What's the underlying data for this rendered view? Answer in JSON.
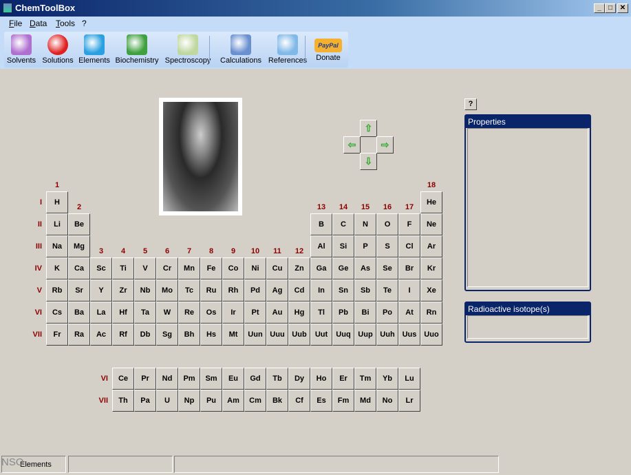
{
  "window": {
    "title": "ChemToolBox",
    "minimize": "_",
    "maximize": "□",
    "close": "✕"
  },
  "menu": [
    "File",
    "Data",
    "Tools",
    "?"
  ],
  "toolbar": [
    {
      "label": "Solvents",
      "icon": "beaker-icon",
      "color": "#b070d0"
    },
    {
      "label": "Solutions",
      "icon": "molecule-icon",
      "color": "#e02020"
    },
    {
      "label": "Elements",
      "icon": "cubes-icon",
      "color": "#2aa0e0"
    },
    {
      "label": "Biochemistry",
      "icon": "protein-icon",
      "color": "#40a040"
    },
    {
      "label": "Spectroscopy",
      "icon": "spectrum-icon",
      "color": "#c0d8a0"
    },
    {
      "label": "Calculations",
      "icon": "calculator-icon",
      "color": "#6a90d0"
    },
    {
      "label": "References",
      "icon": "book-icon",
      "color": "#80b8e8"
    },
    {
      "label": "Donate",
      "icon": "paypal-icon",
      "color": "#f0a020"
    }
  ],
  "paypal_text": "PayPal",
  "groups": [
    "1",
    "2",
    "3",
    "4",
    "5",
    "6",
    "7",
    "8",
    "9",
    "10",
    "11",
    "12",
    "13",
    "14",
    "15",
    "16",
    "17",
    "18"
  ],
  "periods": [
    "I",
    "II",
    "III",
    "IV",
    "V",
    "VI",
    "VII"
  ],
  "elements": [
    [
      "H",
      1,
      1
    ],
    [
      "He",
      18,
      1
    ],
    [
      "Li",
      1,
      2
    ],
    [
      "Be",
      2,
      2
    ],
    [
      "B",
      13,
      2
    ],
    [
      "C",
      14,
      2
    ],
    [
      "N",
      15,
      2
    ],
    [
      "O",
      16,
      2
    ],
    [
      "F",
      17,
      2
    ],
    [
      "Ne",
      18,
      2
    ],
    [
      "Na",
      1,
      3
    ],
    [
      "Mg",
      2,
      3
    ],
    [
      "Al",
      13,
      3
    ],
    [
      "Si",
      14,
      3
    ],
    [
      "P",
      15,
      3
    ],
    [
      "S",
      16,
      3
    ],
    [
      "Cl",
      17,
      3
    ],
    [
      "Ar",
      18,
      3
    ],
    [
      "K",
      1,
      4
    ],
    [
      "Ca",
      2,
      4
    ],
    [
      "Sc",
      3,
      4
    ],
    [
      "Ti",
      4,
      4
    ],
    [
      "V",
      5,
      4
    ],
    [
      "Cr",
      6,
      4
    ],
    [
      "Mn",
      7,
      4
    ],
    [
      "Fe",
      8,
      4
    ],
    [
      "Co",
      9,
      4
    ],
    [
      "Ni",
      10,
      4
    ],
    [
      "Cu",
      11,
      4
    ],
    [
      "Zn",
      12,
      4
    ],
    [
      "Ga",
      13,
      4
    ],
    [
      "Ge",
      14,
      4
    ],
    [
      "As",
      15,
      4
    ],
    [
      "Se",
      16,
      4
    ],
    [
      "Br",
      17,
      4
    ],
    [
      "Kr",
      18,
      4
    ],
    [
      "Rb",
      1,
      5
    ],
    [
      "Sr",
      2,
      5
    ],
    [
      "Y",
      3,
      5
    ],
    [
      "Zr",
      4,
      5
    ],
    [
      "Nb",
      5,
      5
    ],
    [
      "Mo",
      6,
      5
    ],
    [
      "Tc",
      7,
      5
    ],
    [
      "Ru",
      8,
      5
    ],
    [
      "Rh",
      9,
      5
    ],
    [
      "Pd",
      10,
      5
    ],
    [
      "Ag",
      11,
      5
    ],
    [
      "Cd",
      12,
      5
    ],
    [
      "In",
      13,
      5
    ],
    [
      "Sn",
      14,
      5
    ],
    [
      "Sb",
      15,
      5
    ],
    [
      "Te",
      16,
      5
    ],
    [
      "I",
      17,
      5
    ],
    [
      "Xe",
      18,
      5
    ],
    [
      "Cs",
      1,
      6
    ],
    [
      "Ba",
      2,
      6
    ],
    [
      "La",
      3,
      6
    ],
    [
      "Hf",
      4,
      6
    ],
    [
      "Ta",
      5,
      6
    ],
    [
      "W",
      6,
      6
    ],
    [
      "Re",
      7,
      6
    ],
    [
      "Os",
      8,
      6
    ],
    [
      "Ir",
      9,
      6
    ],
    [
      "Pt",
      10,
      6
    ],
    [
      "Au",
      11,
      6
    ],
    [
      "Hg",
      12,
      6
    ],
    [
      "Tl",
      13,
      6
    ],
    [
      "Pb",
      14,
      6
    ],
    [
      "Bi",
      15,
      6
    ],
    [
      "Po",
      16,
      6
    ],
    [
      "At",
      17,
      6
    ],
    [
      "Rn",
      18,
      6
    ],
    [
      "Fr",
      1,
      7
    ],
    [
      "Ra",
      2,
      7
    ],
    [
      "Ac",
      3,
      7
    ],
    [
      "Rf",
      4,
      7
    ],
    [
      "Db",
      5,
      7
    ],
    [
      "Sg",
      6,
      7
    ],
    [
      "Bh",
      7,
      7
    ],
    [
      "Hs",
      8,
      7
    ],
    [
      "Mt",
      9,
      7
    ],
    [
      "Uun",
      10,
      7
    ],
    [
      "Uuu",
      11,
      7
    ],
    [
      "Uub",
      12,
      7
    ],
    [
      "Uut",
      13,
      7
    ],
    [
      "Uuq",
      14,
      7
    ],
    [
      "Uup",
      15,
      7
    ],
    [
      "Uuh",
      16,
      7
    ],
    [
      "Uus",
      17,
      7
    ],
    [
      "Uuo",
      18,
      7
    ]
  ],
  "f_block": {
    "labels": [
      "VI",
      "VII"
    ],
    "rows": [
      [
        "Ce",
        "Pr",
        "Nd",
        "Pm",
        "Sm",
        "Eu",
        "Gd",
        "Tb",
        "Dy",
        "Ho",
        "Er",
        "Tm",
        "Yb",
        "Lu"
      ],
      [
        "Th",
        "Pa",
        "U",
        "Np",
        "Pu",
        "Am",
        "Cm",
        "Bk",
        "Cf",
        "Es",
        "Fm",
        "Md",
        "No",
        "Lr"
      ]
    ]
  },
  "nav": {
    "up": "⇧",
    "left": "⇦",
    "right": "⇨",
    "down": "⇩"
  },
  "help_button": "?",
  "properties": {
    "title": "Properties"
  },
  "radioactive": {
    "title": "Radioactive isotope(s)"
  },
  "status": {
    "panel1": "Elements",
    "watermark": "NSO"
  }
}
